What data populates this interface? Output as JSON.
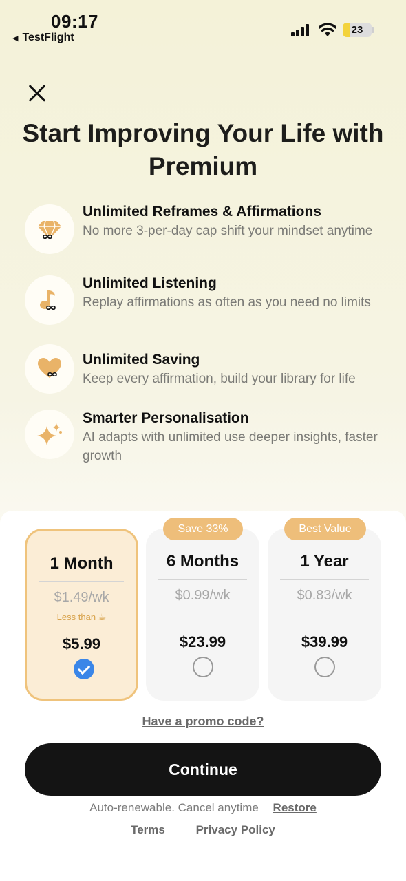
{
  "status_bar": {
    "time": "09:17",
    "back_app": "TestFlight",
    "battery": "23",
    "battery_level": 0.23,
    "battery_color": "#f3d33b"
  },
  "header": {
    "title": "Start Improving Your Life with Premium"
  },
  "features": [
    {
      "icon": "diamond-infinity-icon",
      "title": "Unlimited Reframes & Affirmations",
      "description": "No more 3-per-day cap shift your mindset anytime"
    },
    {
      "icon": "music-note-infinity-icon",
      "title": "Unlimited Listening",
      "description": "Replay affirmations as often as you need no limits"
    },
    {
      "icon": "heart-infinity-icon",
      "title": "Unlimited Saving",
      "description": "Keep every affirmation, build your library for life"
    },
    {
      "icon": "sparkles-icon",
      "title": "Smarter Personalisation",
      "description": "AI adapts with unlimited use deeper insights, faster growth"
    }
  ],
  "plans": [
    {
      "name": "1 Month",
      "weekly": "$1.49/wk",
      "note": "Less than ☕",
      "price": "$5.99",
      "selected": true
    },
    {
      "name": "6 Months",
      "badge": "Save 33%",
      "weekly": "$0.99/wk",
      "price": "$23.99",
      "selected": false
    },
    {
      "name": "1 Year",
      "badge": "Best Value",
      "weekly": "$0.83/wk",
      "price": "$39.99",
      "selected": false
    }
  ],
  "promo_link": "Have a promo code?",
  "continue_label": "Continue",
  "footer": {
    "auto_renew": "Auto-renewable. Cancel anytime",
    "restore": "Restore",
    "terms": "Terms",
    "privacy": "Privacy Policy"
  },
  "colors": {
    "accent": "#efc37c",
    "badge": "#eebe7a",
    "check": "#3a86e8",
    "icon": "#e9b368"
  }
}
